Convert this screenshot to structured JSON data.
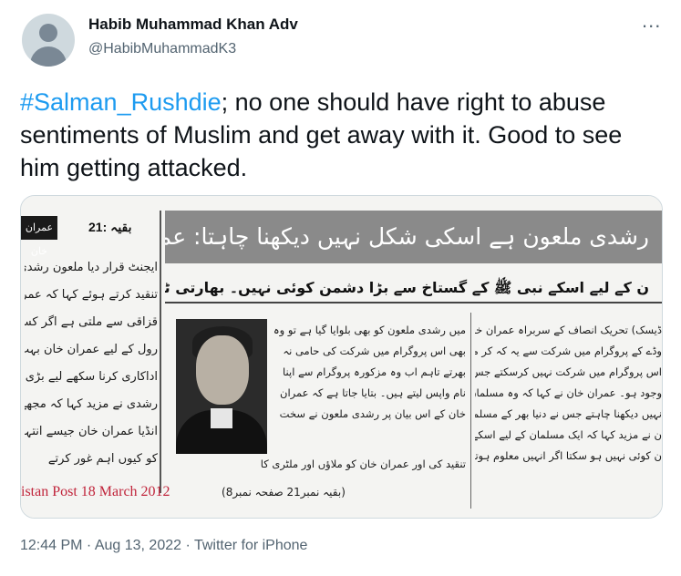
{
  "author": {
    "name": "Habib Muhammad Khan Adv",
    "handle": "@HabibMuhammadK3"
  },
  "more_icon": "...",
  "tweet": {
    "hashtag": "#Salman_Rushdie",
    "text": "; no one should have right to abuse sentiments of Muslim and get away with it. Good to see him getting attacked."
  },
  "newspaper": {
    "baqia": "بقیہ :21",
    "imran_tag": "عمران خان",
    "headline": "رشدی ملعون ہے اسکی شکل نہیں دیکھنا چاہتا: عمران خان",
    "subhead": "ن کے لیے اسکے نبی ﷺ کے گستاخ سے بڑا دشمن کوئی نہیں۔ بھارتی ٹی وی کو جواب",
    "left_lines": [
      "ایجنٹ قرار دیا ملعون رشدی نے",
      "تنقید کرتے ہوئے کہا کہ عمران خان",
      "قزاقی سے ملتی ہے اگر کسی کو قزاقی",
      "رول کے لیے عمران خان بہت موز",
      "اداکاری کرنا سکھے لیے بڑی پریشانی",
      "رشدی نے مزید کہا کہ مجھے یہ بات",
      "انڈیا عمران خان جیسے انتہا پسند او",
      "کو کیوں اہم غور کرتے"
    ],
    "mid_lines": [
      "میں رشدی ملعون کو بھی بلوایا گیا ہے تو وہ کبھی",
      "بھی اس پروگرام میں شرکت کی حامی نہ",
      "بھرتے تاہم اب وہ مزکورہ پروگرام سے اپنا",
      "نام واپس لیتے ہیں۔ بتایا جاتا ہے کہ عمران",
      "خان کے اس بیان پر رشدی ملعون نے سخت"
    ],
    "bottom_lines": [
      "تنقید کی اور عمران خان کو ملاؤں اور ملٹری کا"
    ],
    "right_lines": [
      "ڈیسک) تحریک انصاف کے سربراہ عمران خان",
      "وڈے کے پروگرام میں شرکت سے یہ کہ کر معذرت",
      "اس پروگرام میں شرکت نہیں کرسکتے جس میں ملعون",
      "وجود ہو۔ عمران خان نے کہا کہ وہ مسلمان ہیں اسلیے",
      "نہیں دیکھنا چاہتے جس نے دنیا بھر کے مسلمانوں کی دل",
      "ن نے مزید کہا کہ ایک مسلمان کے لیے اسکے نبی کے",
      "ن کوئی نہیں ہو سکتا اگر انہیں معلوم ہوتا کہ پروگرام"
    ],
    "source": "istan Post 18 March 2012",
    "continued": "(بقیہ نمبر21 صفحہ نمبر8)"
  },
  "meta": {
    "timestamp": "12:44 PM · Aug 13, 2022 · Twitter for iPhone"
  },
  "colors": {
    "hashtag": "#1d9bf0",
    "text": "#0f1419",
    "muted": "#536471",
    "source_red": "#c0233a"
  }
}
